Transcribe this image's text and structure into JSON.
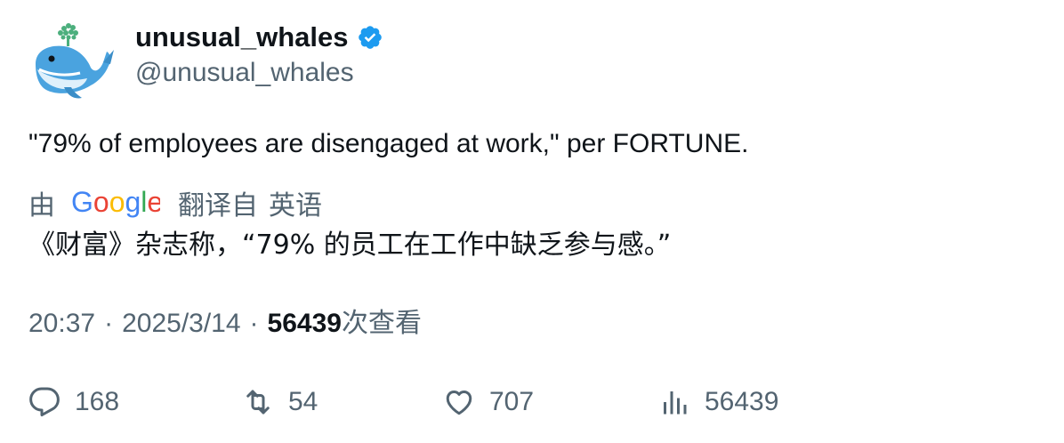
{
  "author": {
    "display_name": "unusual_whales",
    "handle": "@unusual_whales",
    "verified": true,
    "avatar_icon": "whale-avatar-icon",
    "verified_color": "#1d9bf0"
  },
  "tweet": {
    "text": "\"79% of employees are disengaged at work,\" per FORTUNE."
  },
  "translation": {
    "by_label": "由",
    "provider_logo": "Google",
    "from_label": "翻译自",
    "source_language": "英语",
    "text": "《财富》杂志称，“79% 的员工在工作中缺乏参与感。”"
  },
  "meta": {
    "time": "20:37",
    "separator": "·",
    "date": "2025/3/14",
    "views_count": "56439",
    "views_label": "次查看"
  },
  "actions": {
    "replies": "168",
    "reposts": "54",
    "likes": "707",
    "views": "56439"
  },
  "colors": {
    "text_primary": "#0f1419",
    "text_secondary": "#536471",
    "verified_blue": "#1d9bf0"
  }
}
